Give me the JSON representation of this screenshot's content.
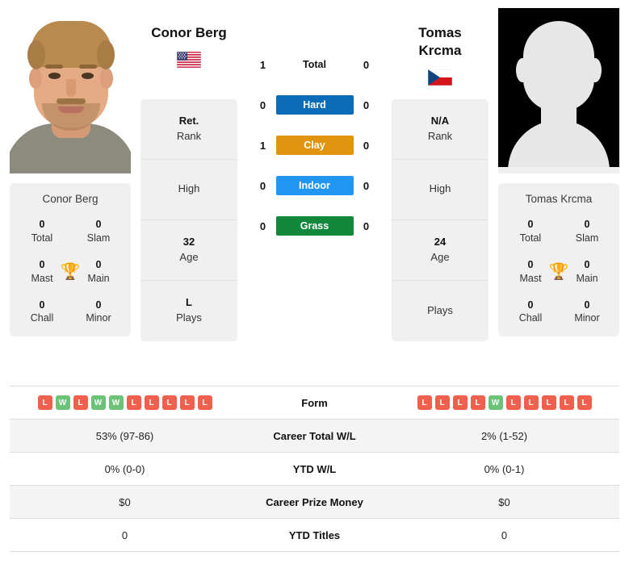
{
  "players": {
    "left": {
      "name": "Conor Berg",
      "name_lines": [
        "Conor Berg"
      ],
      "flag": "us-flag-icon",
      "record_name": "Conor Berg",
      "titles": [
        {
          "value": "0",
          "label": "Total"
        },
        {
          "value": "0",
          "label": "Slam"
        },
        {
          "value": "0",
          "label": "Mast"
        },
        {
          "value": "0",
          "label": "Main"
        },
        {
          "value": "0",
          "label": "Chall"
        },
        {
          "value": "0",
          "label": "Minor"
        }
      ],
      "info": [
        {
          "value": "Ret.",
          "label": "Rank"
        },
        {
          "value": "",
          "label": "High"
        },
        {
          "value": "32",
          "label": "Age"
        },
        {
          "value": "L",
          "label": "Plays"
        }
      ],
      "form": [
        "L",
        "W",
        "L",
        "W",
        "W",
        "L",
        "L",
        "L",
        "L",
        "L"
      ],
      "h2h": {
        "total": "1",
        "hard": "0",
        "clay": "1",
        "indoor": "0",
        "grass": "0"
      }
    },
    "right": {
      "name": "Tomas Krcma",
      "name_lines": [
        "Tomas",
        "Krcma"
      ],
      "flag": "cz-flag-icon",
      "record_name": "Tomas Krcma",
      "titles": [
        {
          "value": "0",
          "label": "Total"
        },
        {
          "value": "0",
          "label": "Slam"
        },
        {
          "value": "0",
          "label": "Mast"
        },
        {
          "value": "0",
          "label": "Main"
        },
        {
          "value": "0",
          "label": "Chall"
        },
        {
          "value": "0",
          "label": "Minor"
        }
      ],
      "info": [
        {
          "value": "N/A",
          "label": "Rank"
        },
        {
          "value": "",
          "label": "High"
        },
        {
          "value": "24",
          "label": "Age"
        },
        {
          "value": "",
          "label": "Plays"
        }
      ],
      "form": [
        "L",
        "L",
        "L",
        "L",
        "W",
        "L",
        "L",
        "L",
        "L",
        "L"
      ],
      "h2h": {
        "total": "0",
        "hard": "0",
        "clay": "0",
        "indoor": "0",
        "grass": "0"
      }
    }
  },
  "surfaces": [
    {
      "key": "total",
      "label": "Total",
      "color": "",
      "plain": true
    },
    {
      "key": "hard",
      "label": "Hard",
      "color": "#0b6cb8",
      "plain": false
    },
    {
      "key": "clay",
      "label": "Clay",
      "color": "#e0940f",
      "plain": false
    },
    {
      "key": "indoor",
      "label": "Indoor",
      "color": "#2196f3",
      "plain": false
    },
    {
      "key": "grass",
      "label": "Grass",
      "color": "#11883c",
      "plain": false
    }
  ],
  "stats_table": {
    "form_label": "Form",
    "rows": [
      {
        "label": "Form",
        "left": "",
        "right": "",
        "form": true
      },
      {
        "label": "Career Total W/L",
        "left": "53% (97-86)",
        "right": "2% (1-52)",
        "form": false
      },
      {
        "label": "YTD W/L",
        "left": "0% (0-0)",
        "right": "0% (0-1)",
        "form": false
      },
      {
        "label": "Career Prize Money",
        "left": "$0",
        "right": "$0",
        "form": false
      },
      {
        "label": "YTD Titles",
        "left": "0",
        "right": "0",
        "form": false
      }
    ]
  },
  "icons": {
    "trophy": "trophy-icon"
  },
  "colors": {
    "win": "#6cc276",
    "loss": "#f0604d",
    "trophy": "#3f6fb5",
    "card_bg": "#f0f0f0",
    "row_alt": "#f4f4f4"
  }
}
